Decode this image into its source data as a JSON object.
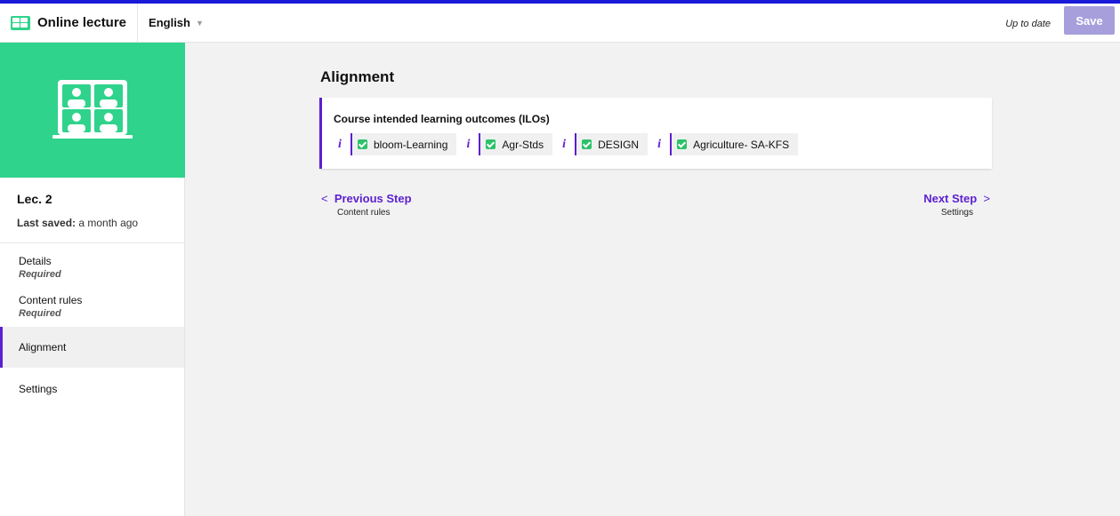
{
  "app": {
    "title": "Online lecture",
    "language": "English",
    "status": "Up to date",
    "save_label": "Save"
  },
  "sidebar": {
    "lecture_title": "Lec. 2",
    "last_saved_label": "Last saved:",
    "last_saved_value": "a month ago",
    "items": [
      {
        "label": "Details",
        "sub": "Required"
      },
      {
        "label": "Content rules",
        "sub": "Required"
      },
      {
        "label": "Alignment"
      },
      {
        "label": "Settings"
      }
    ]
  },
  "main": {
    "title": "Alignment",
    "card_title": "Course intended learning outcomes (ILOs)",
    "info_glyph": "i",
    "tags": [
      "bloom-Learning",
      "Agr-Stds",
      "DESIGN",
      "Agriculture- SA-KFS"
    ],
    "prev": {
      "label": "Previous Step",
      "sub": "Content rules",
      "chevron": "<"
    },
    "next": {
      "label": "Next Step",
      "sub": "Settings",
      "chevron": ">"
    }
  },
  "colors": {
    "accent": "#5b1fd1",
    "green": "#2fd38b",
    "topline": "#1a1ad9",
    "save_bg": "#a69fdc"
  },
  "icons": {
    "brand": "online-lecture-icon",
    "caret": "caret-down-icon",
    "check": "checkbox-checked-icon",
    "info": "info-icon"
  }
}
